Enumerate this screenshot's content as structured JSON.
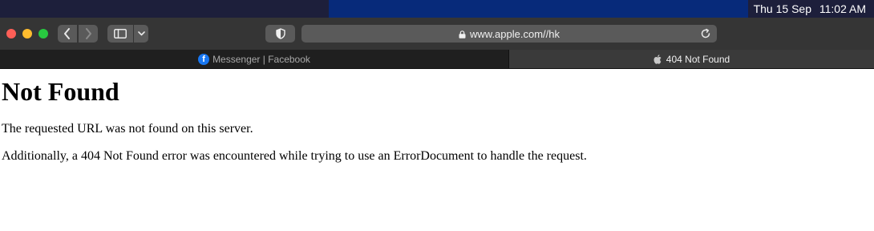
{
  "menubar": {
    "date": "Thu 15 Sep",
    "time": "11:02 AM"
  },
  "toolbar": {
    "back_icon": "chevron-left-icon",
    "forward_icon": "chevron-right-icon",
    "sidebar_icon": "sidebar-icon",
    "privacy_icon": "shield-icon",
    "address": "www.apple.com//hk",
    "reload_icon": "reload-icon"
  },
  "tabs": [
    {
      "label": "Messenger | Facebook",
      "favicon": "facebook-icon",
      "active": false
    },
    {
      "label": "404 Not Found",
      "favicon": "apple-icon",
      "active": true
    }
  ],
  "page": {
    "heading": "Not Found",
    "message": "The requested URL was not found on this server.",
    "details": "Additionally, a 404 Not Found error was encountered while trying to use an ErrorDocument to handle the request."
  },
  "colors": {
    "close": "#fe5f57",
    "minimize": "#febc2e",
    "zoom": "#28c840",
    "toolbar_bg": "#353535"
  }
}
